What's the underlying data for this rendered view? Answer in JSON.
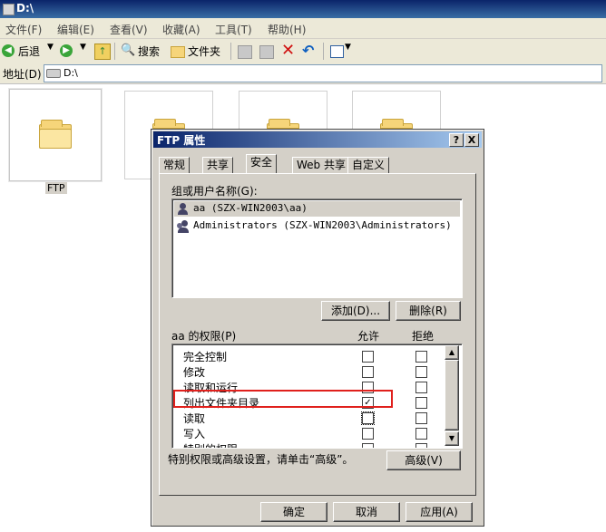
{
  "window": {
    "title": "D:\\"
  },
  "menu": [
    "文件(F)",
    "编辑(E)",
    "查看(V)",
    "收藏(A)",
    "工具(T)",
    "帮助(H)"
  ],
  "toolbar": {
    "back": "后退",
    "search": "搜索",
    "folders": "文件夹"
  },
  "address": {
    "label": "地址(D)",
    "value": "D:\\"
  },
  "folders": [
    {
      "name": "FTP",
      "selected": true
    },
    {
      "name": "",
      "selected": false
    },
    {
      "name": "",
      "selected": false
    },
    {
      "name": "",
      "selected": false
    }
  ],
  "dialog": {
    "title": "FTP 属性",
    "help": "?",
    "close": "X",
    "tabs": [
      "常规",
      "共享",
      "安全",
      "Web 共享",
      "自定义"
    ],
    "active_tab": "安全",
    "group_label": "组或用户名称(G):",
    "users": [
      {
        "name": "aa (SZX-WIN2003\\aa)",
        "selected": true
      },
      {
        "name": "Administrators (SZX-WIN2003\\Administrators)",
        "selected": false
      }
    ],
    "add_button": "添加(D)...",
    "remove_button": "删除(R)",
    "perm_label": "aa 的权限(P)",
    "allow_header": "允许",
    "deny_header": "拒绝",
    "permissions": [
      {
        "name": "完全控制",
        "allow": false,
        "deny": false
      },
      {
        "name": "修改",
        "allow": false,
        "deny": false
      },
      {
        "name": "读取和运行",
        "allow": false,
        "deny": false
      },
      {
        "name": "列出文件夹目录",
        "allow": true,
        "deny": false,
        "highlighted": true
      },
      {
        "name": "读取",
        "allow": false,
        "deny": false
      },
      {
        "name": "写入",
        "allow": false,
        "deny": false
      },
      {
        "name": "特别的权限",
        "allow": false,
        "deny": false
      }
    ],
    "advanced_text": "特别权限或高级设置，请单击“高级”。",
    "advanced_button": "高级(V)",
    "ok_button": "确定",
    "cancel_button": "取消",
    "apply_button": "应用(A)"
  },
  "colors": {
    "highlight": "#e0201c",
    "titlebar": "#0a246a",
    "dialog_bg": "#d4d0c8"
  }
}
